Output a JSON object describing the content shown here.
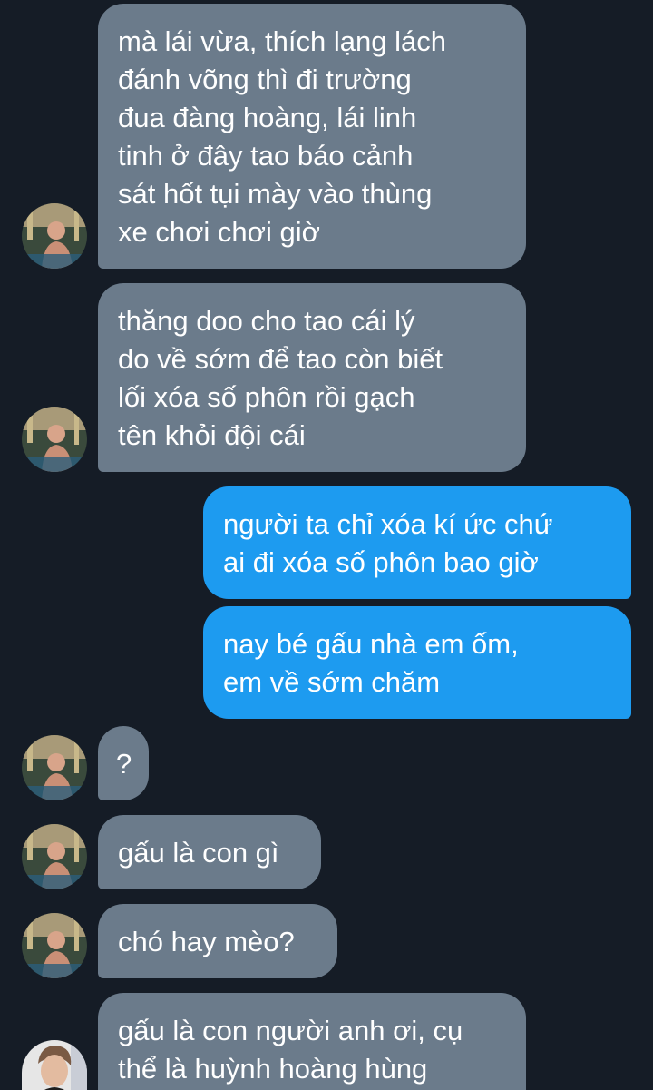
{
  "messages": [
    {
      "id": "m1",
      "direction": "incoming",
      "text": "mà lái vừa, thích lạng lách\nđánh võng thì đi trường\nđua đàng hoàng, lái linh\ntinh ở đây tao báo cảnh\nsát hốt tụi mày vào thùng\nxe chơi chơi giờ"
    },
    {
      "id": "m2",
      "direction": "incoming",
      "text": "thăng doo cho tao cái lý\ndo về sớm để tao còn biết\nlối xóa số phôn rồi gạch\ntên khỏi đội cái"
    },
    {
      "id": "m3",
      "direction": "outgoing",
      "text": "người ta chỉ xóa kí ức chứ\nai đi xóa số phôn bao giờ"
    },
    {
      "id": "m4",
      "direction": "outgoing",
      "text": "nay bé gấu nhà em ốm,\nem về sớm chăm"
    },
    {
      "id": "m5",
      "direction": "incoming",
      "text": "?"
    },
    {
      "id": "m6",
      "direction": "incoming",
      "text": "gấu là con gì"
    },
    {
      "id": "m7",
      "direction": "incoming",
      "text": "chó hay mèo?"
    },
    {
      "id": "m8",
      "direction": "incoming",
      "text": "gấu là con người anh ơi, cụ\nthể là huỳnh hoàng hùng"
    }
  ],
  "colors": {
    "background": "#151c26",
    "incoming_bubble": "#6b7b8b",
    "outgoing_bubble": "#1d9bf0",
    "text": "#ffffff"
  }
}
